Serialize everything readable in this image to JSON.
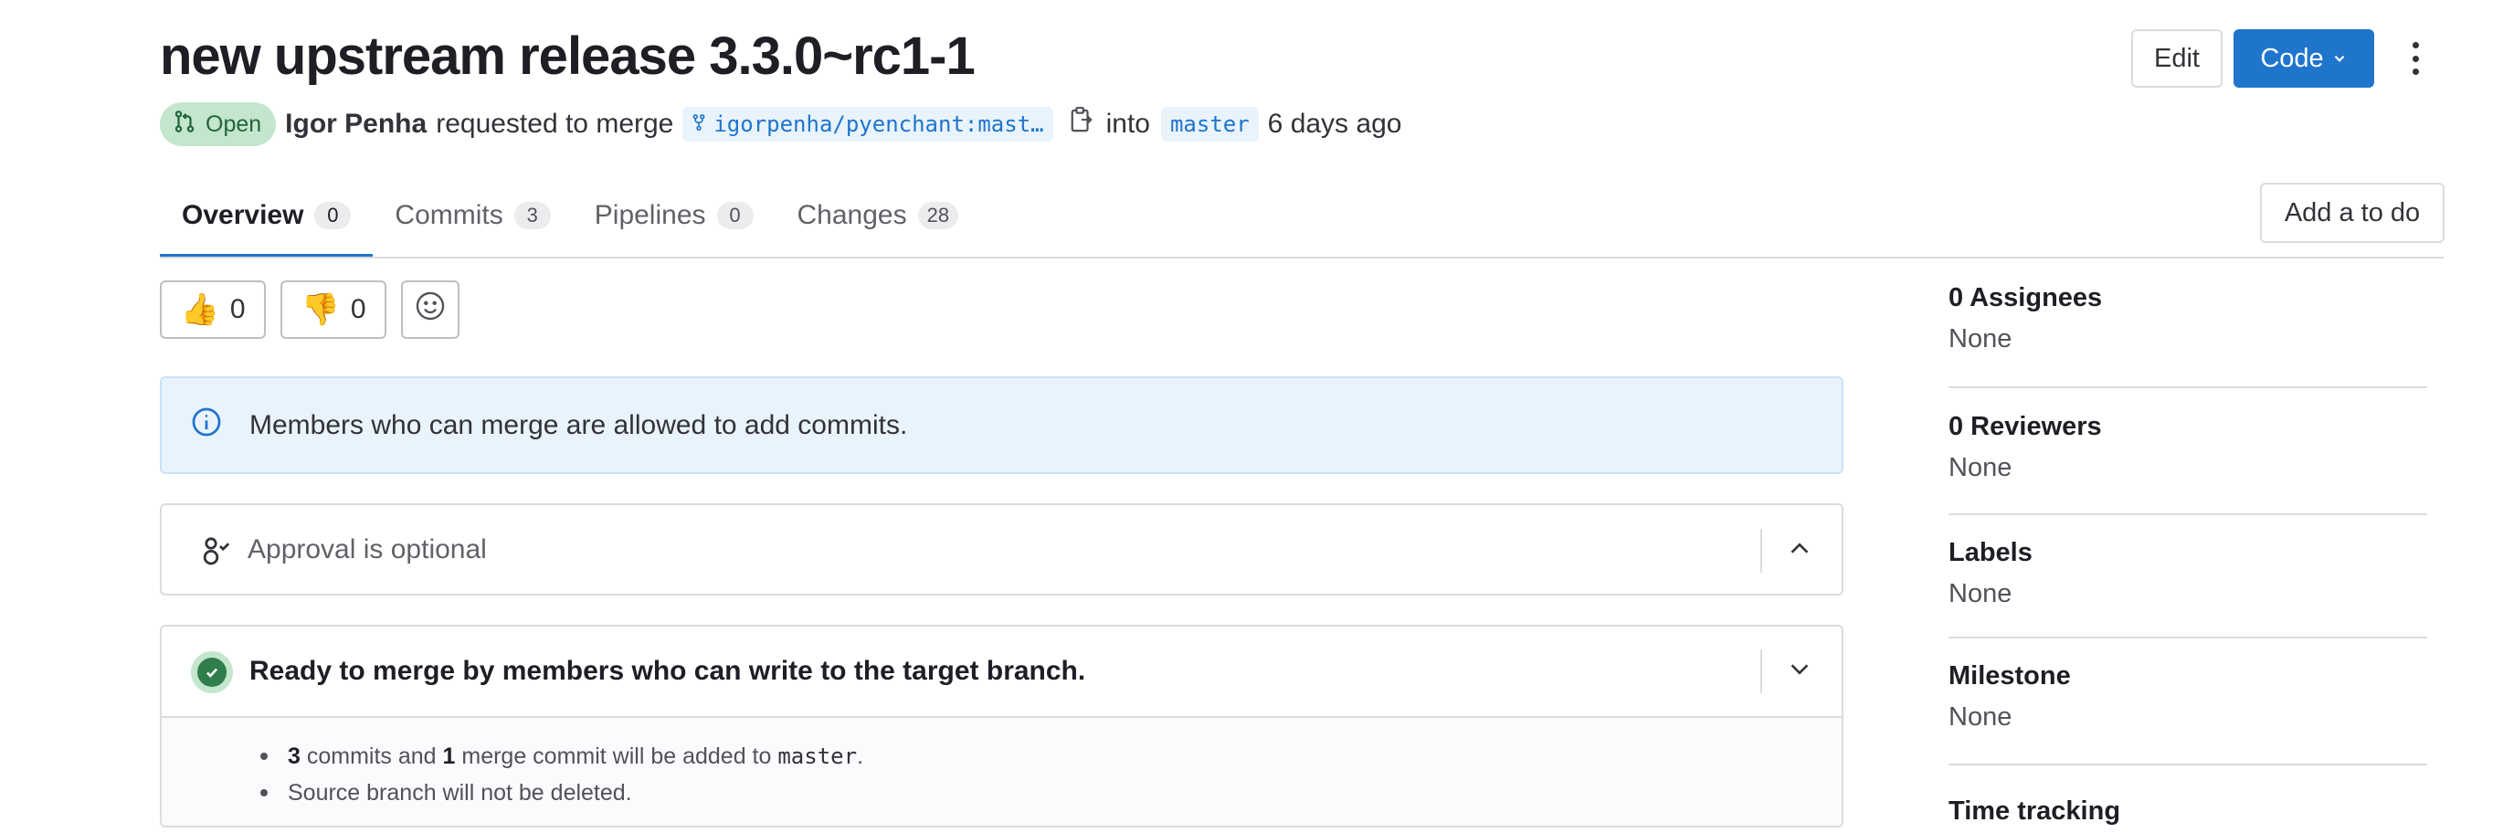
{
  "header": {
    "title": "new upstream release 3.3.0~rc1-1",
    "status": "Open",
    "author": "Igor Penha",
    "action_text": "requested to merge",
    "source_branch": "igorpenha/pyenchant:mast…",
    "into_text": "into",
    "target_branch": "master",
    "time_ago": "6 days ago"
  },
  "actions": {
    "edit_label": "Edit",
    "code_label": "Code",
    "todo_label": "Add a to do"
  },
  "tabs": [
    {
      "label": "Overview",
      "count": "0"
    },
    {
      "label": "Commits",
      "count": "3"
    },
    {
      "label": "Pipelines",
      "count": "0"
    },
    {
      "label": "Changes",
      "count": "28"
    }
  ],
  "awards": {
    "thumbs_up": {
      "emoji": "👍",
      "count": "0"
    },
    "thumbs_down": {
      "emoji": "👎",
      "count": "0"
    }
  },
  "alert": {
    "text": "Members who can merge are allowed to add commits."
  },
  "approval": {
    "text": "Approval is optional"
  },
  "merge": {
    "title": "Ready to merge by members who can write to the target branch.",
    "commits_count": "3",
    "commits_text": " commits and ",
    "merge_commits_count": "1",
    "merge_text": " merge commit will be added to ",
    "target": "master",
    "period": ".",
    "branch_note": "Source branch will not be deleted."
  },
  "sidebar": {
    "assignees": {
      "title": "0 Assignees",
      "value": "None"
    },
    "reviewers": {
      "title": "0 Reviewers",
      "value": "None"
    },
    "labels": {
      "title": "Labels",
      "value": "None"
    },
    "milestone": {
      "title": "Milestone",
      "value": "None"
    },
    "time_tracking": {
      "title": "Time tracking"
    }
  },
  "colors": {
    "accent": "#1f75cb",
    "status_open_bg": "#c3e6cd",
    "status_open_fg": "#24663b",
    "success": "#2f7d4c",
    "info_bg": "#e9f3fc"
  },
  "icons": {
    "status": "merge-request-icon",
    "branch": "fork-icon",
    "copy": "clipboard-icon",
    "code_caret": "chevron-down-icon",
    "more": "kebab-icon",
    "add_reaction": "smiley-icon",
    "info": "info-circle-icon",
    "approval": "approval-user-icon",
    "collapse": "chevron-up-icon",
    "expand": "chevron-down-icon",
    "merge_ready": "check-circle-icon"
  }
}
